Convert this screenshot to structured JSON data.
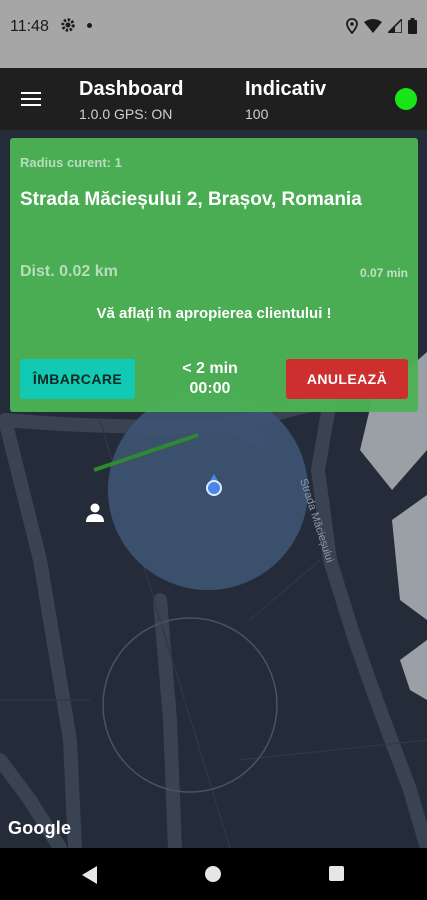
{
  "status_bar": {
    "time": "11:48",
    "icons": [
      "gear-icon",
      "notification-dot",
      "location-icon",
      "wifi-icon",
      "signal-icon",
      "battery-icon"
    ]
  },
  "app_bar": {
    "menu_icon": "hamburger-menu-icon",
    "title": "Dashboard",
    "subtitle": "1.0.0 GPS: ON",
    "indicativ_label": "Indicativ",
    "indicativ_value": "100",
    "status_color": "#19e619"
  },
  "card": {
    "radius": "Radius curent: 1",
    "address": "Strada Măcieșului 2, Brașov, Romania",
    "distance": "Dist. 0.02 km",
    "duration": "0.07 min",
    "proximity": "Vă aflați în apropierea clientului !",
    "board_label": "ÎMBARCARE",
    "eta": "< 2 min",
    "timer": "00:00",
    "cancel_label": "ANULEAZĂ",
    "accent": "#4cb254"
  },
  "map": {
    "street_label": "Strada Măcieșului",
    "attribution": "Google",
    "icons": [
      "driver-location-icon",
      "client-person-icon"
    ]
  },
  "nav_bar": {
    "icons": [
      "back-icon",
      "home-icon",
      "recents-icon"
    ]
  }
}
